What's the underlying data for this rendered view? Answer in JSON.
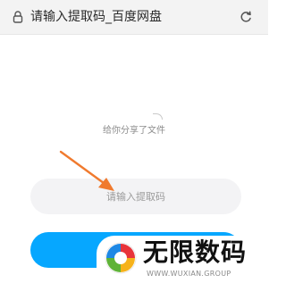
{
  "browser": {
    "page_title": "请输入提取码_百度网盘",
    "icons": {
      "lock": "lock-icon",
      "reload": "reload-icon"
    }
  },
  "share": {
    "message": "给你分享了文件"
  },
  "extract_code": {
    "value": "",
    "placeholder": "请输入提取码"
  },
  "submit_button": {
    "label": ""
  },
  "watermark": {
    "name": "无限数码",
    "url": "WWW.WUXIAN.GROUP"
  },
  "colors": {
    "accent_button": "#06a7ff",
    "input_background": "#f3f3f5",
    "annotation_arrow": "#f07a2e",
    "address_bar": "#f3f3f3"
  }
}
